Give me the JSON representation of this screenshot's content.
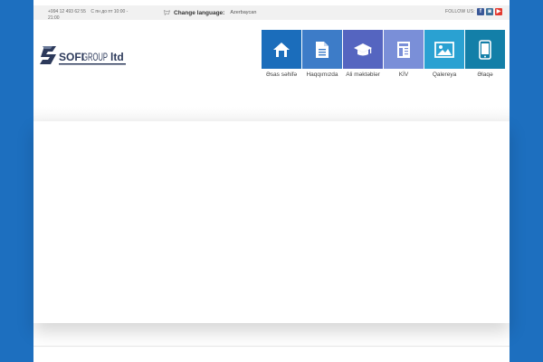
{
  "topbar": {
    "phone": "+994 12 493 62 55",
    "hours": "С пн до пт 10:00 - 21:00",
    "change_language_label": "Change language:",
    "current_language": "Azerbaycan",
    "follow_label": "FOLLOW US:",
    "socials": [
      {
        "name": "facebook",
        "glyph": "f",
        "color": "#3b5998"
      },
      {
        "name": "instagram",
        "glyph": "◙",
        "color": "#3f729b"
      },
      {
        "name": "youtube",
        "glyph": "▶",
        "color": "#e33a30"
      }
    ]
  },
  "logo": {
    "text_main": "SOFI",
    "text_group": "GROUP",
    "text_ltd": "ltd"
  },
  "nav": {
    "items": [
      {
        "label": "Əsas səhifə",
        "icon": "home-icon",
        "color": "#1b6dbb"
      },
      {
        "label": "Haqqımızda",
        "icon": "document-icon",
        "color": "#3d7cc8"
      },
      {
        "label": "Ali məktəblər",
        "icon": "graduation-cap-icon",
        "color": "#5565c0"
      },
      {
        "label": "KİV",
        "icon": "newspaper-icon",
        "color": "#7a8fd8"
      },
      {
        "label": "Qalereya",
        "icon": "image-icon",
        "color": "#2aa1d2"
      },
      {
        "label": "Əlaqə",
        "icon": "mobile-phone-icon",
        "color": "#137fa8"
      }
    ]
  }
}
